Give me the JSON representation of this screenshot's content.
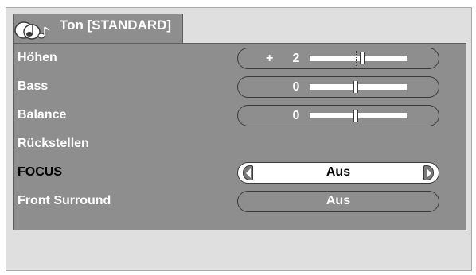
{
  "header": {
    "title": "Ton [STANDARD]",
    "icon": "sound-notes-icon"
  },
  "menu": {
    "items": [
      {
        "label": "Höhen",
        "control": "slider",
        "sign": "+",
        "value": "2",
        "level": 2,
        "min": -15,
        "max": 15
      },
      {
        "label": "Bass",
        "control": "slider",
        "sign": "",
        "value": "0",
        "level": 0,
        "min": -15,
        "max": 15
      },
      {
        "label": "Balance",
        "control": "slider",
        "sign": "",
        "value": "0",
        "level": 0,
        "min": -15,
        "max": 15
      },
      {
        "label": "Rückstellen",
        "control": "none"
      },
      {
        "label": "FOCUS",
        "control": "selector",
        "value": "Aus",
        "selected": true
      },
      {
        "label": "Front Surround",
        "control": "pill",
        "value": "Aus"
      }
    ]
  },
  "colors": {
    "panel": "#dfdfdf",
    "menu_bg": "#8e8e8e",
    "text": "#ffffff",
    "selected_text": "#000000",
    "outline": "#3a3a3a"
  }
}
